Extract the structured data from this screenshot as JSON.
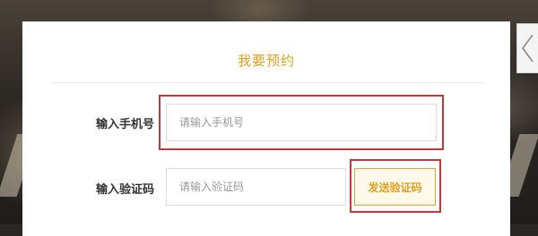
{
  "modal": {
    "title": "我要预约",
    "phone": {
      "label": "输入手机号",
      "placeholder": "请输入手机号",
      "value": ""
    },
    "code": {
      "label": "输入验证码",
      "placeholder": "请输入验证码",
      "value": ""
    },
    "send_code_label": "发送验证码"
  },
  "icons": {
    "side_arrow": "chevron-left-icon"
  },
  "colors": {
    "accent": "#e0a020",
    "highlight": "#c0393f",
    "button_background": "#fff9ec"
  }
}
